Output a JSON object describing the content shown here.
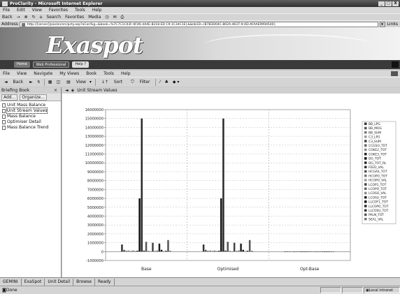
{
  "window": {
    "title": "ProClarity - Microsoft Internet Explorer",
    "controls": [
      "_",
      "□",
      "X"
    ]
  },
  "ie_menu": [
    "File",
    "Edit",
    "View",
    "Favorites",
    "Tools",
    "Help"
  ],
  "ie_toolbar": {
    "back": "Back",
    "search": "Search",
    "favorites": "Favorites",
    "media": "Media"
  },
  "address": {
    "label": "Address",
    "url": "http://[server]/pas/en/src/pcty.asp?aCon%g=&book=%7C7C1C03F-0F46-4A4E-8218-ED C9:1C34C1E}&&lib1D=(B7B3D04C-802A-4637-9:AD-AFAAE9994540}",
    "links": "Links"
  },
  "banner": {
    "logo": "Exaspot",
    "tabs": [
      "Home",
      "Web Professional",
      "Help"
    ]
  },
  "app_menu": [
    "File",
    "View",
    "Navigate",
    "My Views",
    "Book",
    "Tools",
    "Help"
  ],
  "app_toolbar": {
    "back": "Back",
    "view": "View",
    "sort": "Sort",
    "filter": "Filter"
  },
  "left_pane": {
    "title": "Briefing Book",
    "add": "Add...",
    "organize": "Organize...",
    "items": [
      "Unit Mass Balance",
      "Unit Stream Values",
      "Mass Balance",
      "Optimiser Detail",
      "Mass Balance Trend"
    ],
    "selected_index": 1
  },
  "main_pane": {
    "title": "Unit Stream Values"
  },
  "chart_data": {
    "type": "bar",
    "categories": [
      "Base",
      "Optimised",
      "Opt-Base"
    ],
    "ylim": [
      -1000000,
      16000000
    ],
    "yticks": [
      16000000,
      15000000,
      14000000,
      13000000,
      12000000,
      11000000,
      10000000,
      9000000,
      8000000,
      7000000,
      6000000,
      5000000,
      4000000,
      3000000,
      2000000,
      1000000,
      0,
      -1000000
    ],
    "grid": true,
    "legend_position": "right",
    "series": [
      {
        "name": "BB_LPG",
        "values": [
          800000,
          800000,
          0
        ]
      },
      {
        "name": "BB_MOG",
        "values": [
          200000,
          200000,
          0
        ]
      },
      {
        "name": "BB_SUM",
        "values": [
          100000,
          100000,
          0
        ]
      },
      {
        "name": "C3_LPG",
        "values": [
          150000,
          150000,
          0
        ]
      },
      {
        "name": "C3_SUM",
        "values": [
          60000,
          60000,
          0
        ]
      },
      {
        "name": "CCGSO_TOT",
        "values": [
          120000,
          120000,
          0
        ]
      },
      {
        "name": "COKE2_TOT",
        "values": [
          80000,
          80000,
          0
        ]
      },
      {
        "name": "COKE3_TOT",
        "values": [
          100000,
          100000,
          0
        ]
      },
      {
        "name": "DG_TOT",
        "values": [
          6000000,
          6000000,
          0
        ]
      },
      {
        "name": "DG_TOT_RL",
        "values": [
          15000000,
          15000000,
          0
        ]
      },
      {
        "name": "FEED_VAL",
        "values": [
          120000,
          120000,
          0
        ]
      },
      {
        "name": "HCGAS_TOT",
        "values": [
          1100000,
          1100000,
          0
        ]
      },
      {
        "name": "HCOPO_TOT",
        "values": [
          80000,
          80000,
          0
        ]
      },
      {
        "name": "HCOPO_VAL",
        "values": [
          60000,
          60000,
          0
        ]
      },
      {
        "name": "LCOP1_TOT",
        "values": [
          1000000,
          1000000,
          0
        ]
      },
      {
        "name": "LCOPO_TOT",
        "values": [
          70000,
          70000,
          0
        ]
      },
      {
        "name": "LCOSO_VAL",
        "values": [
          150000,
          150000,
          0
        ]
      },
      {
        "name": "LCOSU_TOT",
        "values": [
          900000,
          900000,
          0
        ]
      },
      {
        "name": "LLCOF1_TOT",
        "values": [
          200000,
          200000,
          0
        ]
      },
      {
        "name": "LLCOPO_TOT",
        "values": [
          40000,
          40000,
          0
        ]
      },
      {
        "name": "LLCOSU_TOT",
        "values": [
          100000,
          100000,
          0
        ]
      },
      {
        "name": "PALN_TOT",
        "values": [
          1300000,
          1300000,
          0
        ]
      },
      {
        "name": "SEAL_VAL",
        "values": [
          100000,
          100000,
          0
        ]
      }
    ]
  },
  "bottom_tabs": [
    "GEMINI",
    "ExaSpot",
    "Unit Detail",
    "Browse",
    "Ready"
  ],
  "status": {
    "left": "Done",
    "zone": "Local intranet"
  }
}
